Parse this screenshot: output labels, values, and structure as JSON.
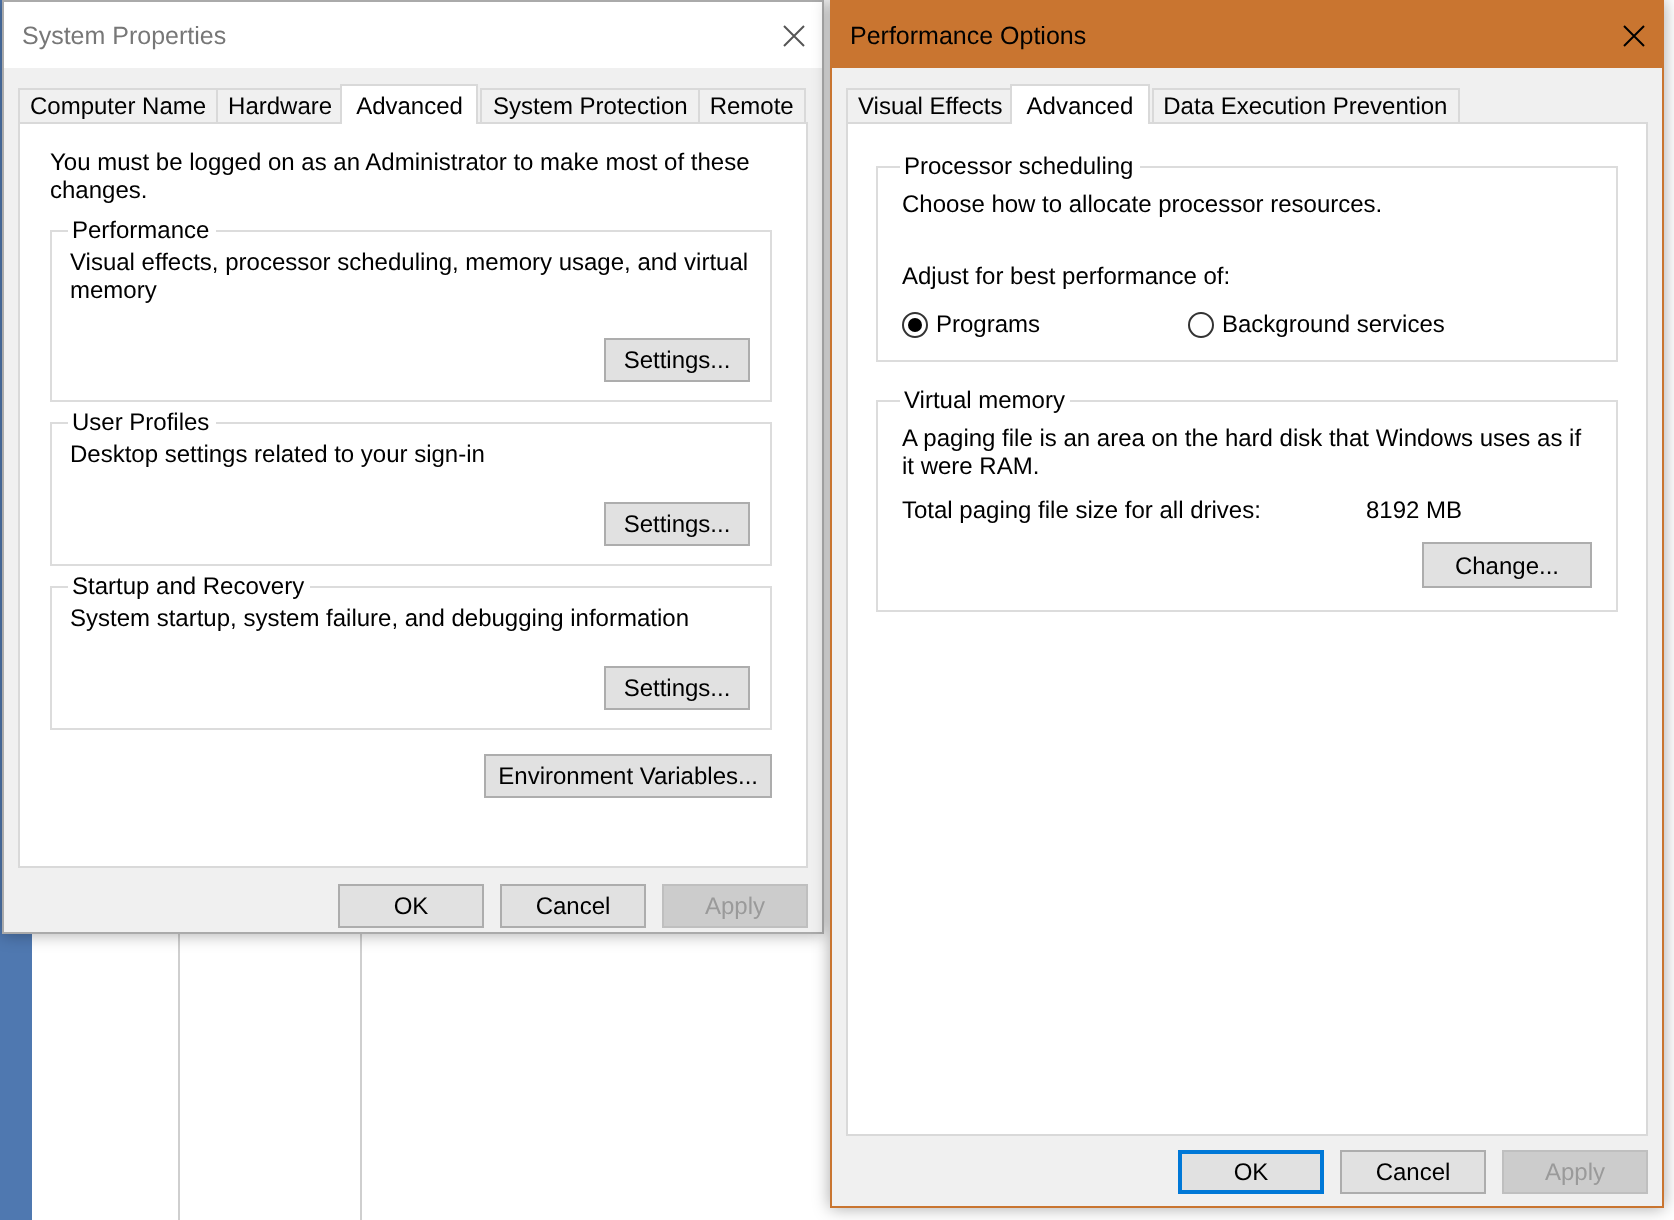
{
  "system_properties": {
    "title": "System Properties",
    "active": false,
    "tabs": [
      {
        "label": "Computer Name",
        "selected": false
      },
      {
        "label": "Hardware",
        "selected": false
      },
      {
        "label": "Advanced",
        "selected": true
      },
      {
        "label": "System Protection",
        "selected": false
      },
      {
        "label": "Remote",
        "selected": false
      }
    ],
    "notice": "You must be logged on as an Administrator to make most of these changes.",
    "groups": [
      {
        "title": "Performance",
        "description": "Visual effects, processor scheduling, memory usage, and virtual memory",
        "button": "Settings..."
      },
      {
        "title": "User Profiles",
        "description": "Desktop settings related to your sign-in",
        "button": "Settings..."
      },
      {
        "title": "Startup and Recovery",
        "description": "System startup, system failure, and debugging information",
        "button": "Settings..."
      }
    ],
    "environment_button": "Environment Variables...",
    "buttons": [
      {
        "label": "OK",
        "disabled": false,
        "default": false
      },
      {
        "label": "Cancel",
        "disabled": false,
        "default": false
      },
      {
        "label": "Apply",
        "disabled": true,
        "default": false
      }
    ]
  },
  "performance_options": {
    "title": "Performance Options",
    "active": true,
    "tabs": [
      {
        "label": "Visual Effects",
        "selected": false
      },
      {
        "label": "Advanced",
        "selected": true
      },
      {
        "label": "Data Execution Prevention",
        "selected": false
      }
    ],
    "processor_scheduling": {
      "title": "Processor scheduling",
      "description": "Choose how to allocate processor resources.",
      "prompt": "Adjust for best performance of:",
      "options": [
        {
          "label": "Programs",
          "selected": true
        },
        {
          "label": "Background services",
          "selected": false
        }
      ]
    },
    "virtual_memory": {
      "title": "Virtual memory",
      "description": "A paging file is an area on the hard disk that Windows uses as if it were RAM.",
      "total_label": "Total paging file size for all drives:",
      "total_value": "8192 MB",
      "button": "Change..."
    },
    "buttons": [
      {
        "label": "OK",
        "disabled": false,
        "default": true
      },
      {
        "label": "Cancel",
        "disabled": false,
        "default": false
      },
      {
        "label": "Apply",
        "disabled": true,
        "default": false
      }
    ]
  }
}
